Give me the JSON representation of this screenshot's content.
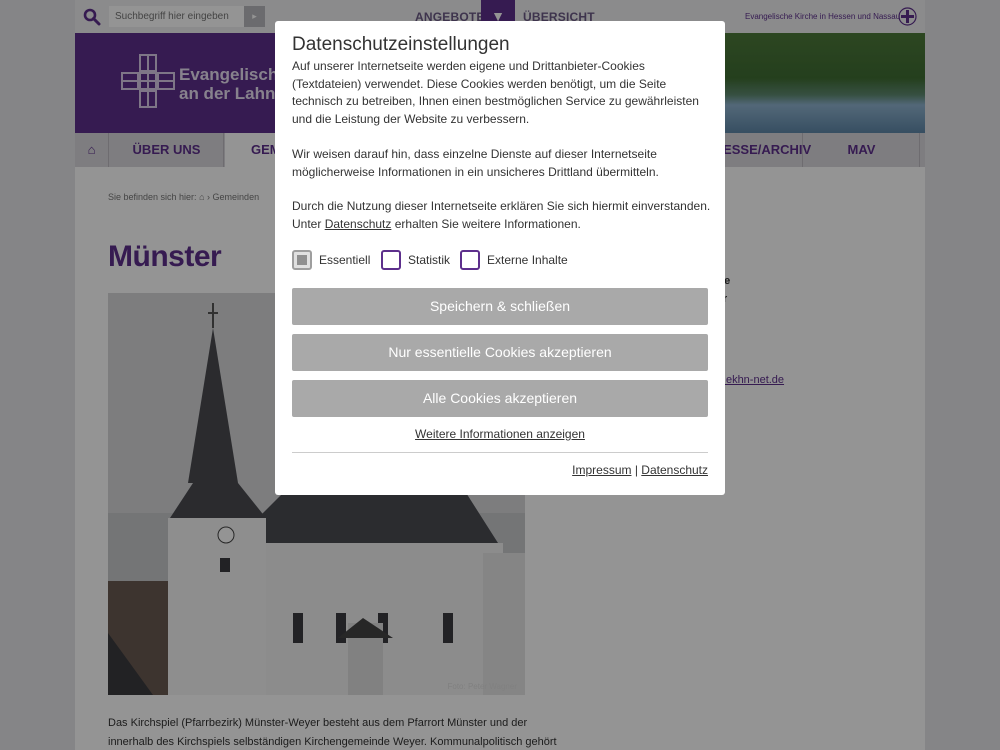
{
  "topbar": {
    "search_placeholder": "Suchbegriff hier eingeben",
    "search_button": "▸",
    "link_angebote": "ANGEBOTE",
    "toggle_icon": "▼",
    "link_uebersicht": "ÜBERSICHT",
    "ekhn_text": "Evangelische Kirche in Hessen und Nassau"
  },
  "header": {
    "title_line1": "Evangelisches",
    "title_line2": "an der Lahn"
  },
  "nav": {
    "home_icon": "⌂",
    "items": [
      "ÜBER UNS",
      "GEM",
      "PRESSE/ARCHIV",
      "MAV"
    ]
  },
  "breadcrumb": {
    "prefix": "Sie befinden sich hier:",
    "home_icon": "⌂",
    "separator": "›",
    "item": "Gemeinden"
  },
  "page": {
    "title": "Münster",
    "photo_credit": "Foto: Peter Wagner",
    "side_line1": "tätte",
    "side_line2": "ster",
    "side_email": "er@ekhn-net.de",
    "body_line1": "Das Kirchspiel (Pfarrbezirk) Münster-Weyer besteht aus dem Pfarrort Münster und der",
    "body_line2": "innerhalb des Kirchspiels selbständigen Kirchengemeinde Weyer. Kommunalpolitisch gehört"
  },
  "cookie_modal": {
    "title": "Datenschutzeinstellungen",
    "paragraph1": "Auf unserer Internetseite werden eigene und Drittanbieter-Cookies (Textdateien) verwendet. Diese Cookies werden benötigt, um die Seite technisch zu betreiben, Ihnen einen bestmöglichen Service zu gewährleisten und die Leistung der Website zu verbessern.",
    "paragraph2": "Wir weisen darauf hin, dass einzelne Dienste auf dieser Internetseite möglicherweise Informationen in ein unsicheres Drittland übermitteln.",
    "paragraph3_start": "Durch die Nutzung dieser Internetseite erklären Sie sich hiermit einverstanden. Unter ",
    "paragraph3_link": "Datenschutz",
    "paragraph3_end": " erhalten Sie weitere Informationen.",
    "checkboxes": [
      {
        "label": "Essentiell",
        "checked": true,
        "disabled": true
      },
      {
        "label": "Statistik",
        "checked": false
      },
      {
        "label": "Externe Inhalte",
        "checked": false
      }
    ],
    "btn_save": "Speichern & schließen",
    "btn_essential": "Nur essentielle Cookies akzeptieren",
    "btn_all": "Alle Cookies akzeptieren",
    "more_info": "Weitere Informationen anzeigen",
    "footer_impressum": "Impressum",
    "footer_sep": "|",
    "footer_datenschutz": "Datenschutz"
  },
  "colors": {
    "brand_purple": "#5d2f8c",
    "button_gray": "#a9a9a9"
  }
}
